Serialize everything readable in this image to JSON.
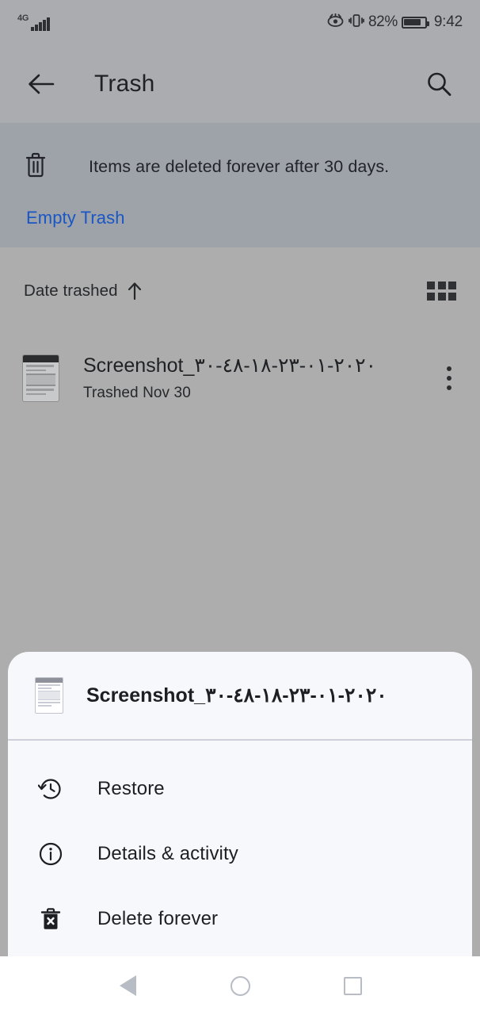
{
  "status_bar": {
    "network_type": "4G",
    "signal_icon": "signal-bars-icon",
    "eye_icon": "eye-comfort-icon",
    "vibrate_icon": "vibrate-icon",
    "battery_percent": "82%",
    "battery_icon": "battery-icon",
    "time": "9:42"
  },
  "app_bar": {
    "back_icon": "back-arrow-icon",
    "title": "Trash",
    "search_icon": "search-icon"
  },
  "banner": {
    "trash_icon": "trash-icon",
    "message": "Items are deleted forever after 30 days.",
    "action_label": "Empty Trash",
    "action_color": "#1a56c4"
  },
  "sort_row": {
    "label": "Date trashed",
    "direction_icon": "arrow-up-icon",
    "view_toggle_icon": "grid-view-icon"
  },
  "file_list": {
    "items": [
      {
        "thumbnail_icon": "screenshot-thumbnail",
        "name": "Screenshot_٢٠٢٠-٠١-٢٣-١٨-٤٨-٣٠",
        "subtitle": "Trashed Nov 30",
        "overflow_icon": "more-vertical-icon"
      }
    ]
  },
  "bottom_sheet": {
    "header": {
      "thumbnail_icon": "screenshot-thumbnail",
      "file_name": "Screenshot_٢٠٢٠-٠١-٢٣-١٨-٤٨-٣٠"
    },
    "menu_items": [
      {
        "icon": "restore-history-icon",
        "label": "Restore"
      },
      {
        "icon": "info-circle-icon",
        "label": "Details & activity"
      },
      {
        "icon": "delete-forever-icon",
        "label": "Delete forever"
      }
    ]
  },
  "nav_bar": {
    "back_icon": "nav-back-icon",
    "home_icon": "nav-home-icon",
    "recents_icon": "nav-recents-icon"
  }
}
